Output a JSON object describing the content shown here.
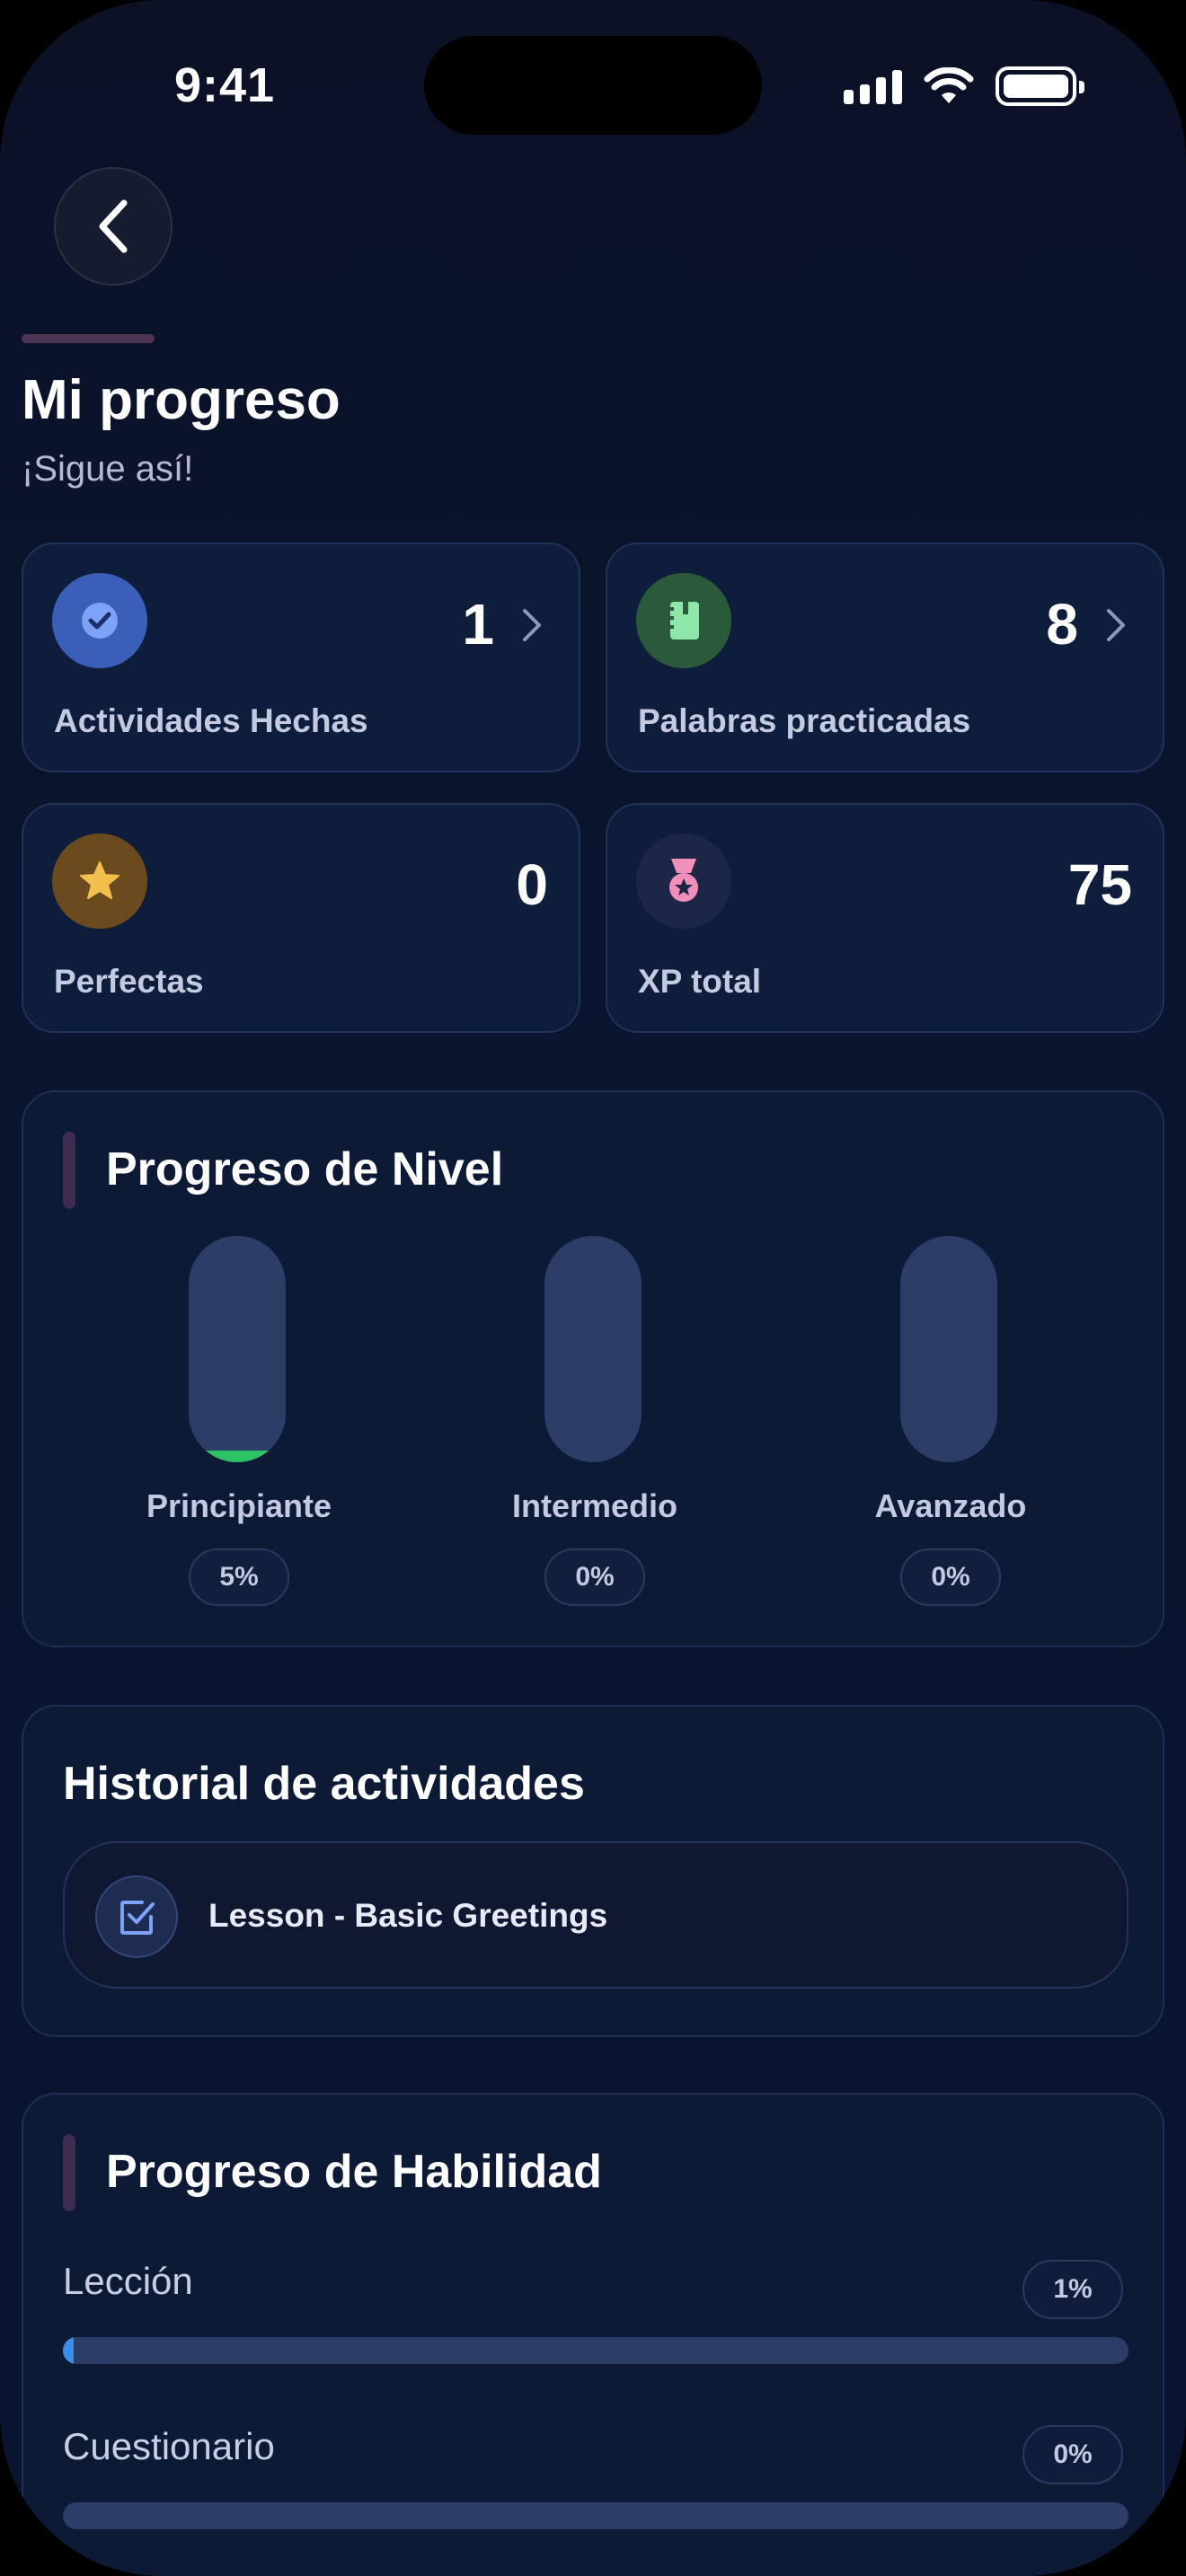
{
  "status_bar": {
    "time": "9:41"
  },
  "header": {
    "title": "Mi progreso",
    "subtitle": "¡Sigue así!"
  },
  "stats": [
    {
      "label": "Actividades Hechas",
      "value": "1",
      "icon": "check-circle-icon",
      "color": "#3b5fb8",
      "has_chevron": true
    },
    {
      "label": "Palabras practicadas",
      "value": "8",
      "icon": "notebook-icon",
      "color": "#2b5a3a",
      "has_chevron": true
    },
    {
      "label": "Perfectas",
      "value": "0",
      "icon": "star-icon",
      "color": "#6b4a1e",
      "has_chevron": false
    },
    {
      "label": "XP total",
      "value": "75",
      "icon": "medal-icon",
      "color": "#1c2647",
      "has_chevron": false
    }
  ],
  "level_progress": {
    "title": "Progreso de Nivel",
    "levels": [
      {
        "name": "Principiante",
        "percent_label": "5%",
        "fraction": 0.05
      },
      {
        "name": "Intermedio",
        "percent_label": "0%",
        "fraction": 0
      },
      {
        "name": "Avanzado",
        "percent_label": "0%",
        "fraction": 0
      }
    ]
  },
  "history": {
    "title": "Historial de actividades",
    "items": [
      {
        "label": "Lesson - Basic Greetings",
        "icon": "checkbox-icon"
      }
    ]
  },
  "skill_progress": {
    "title": "Progreso de Habilidad",
    "skills": [
      {
        "name": "Lección",
        "percent_label": "1%",
        "fraction": 0.01
      },
      {
        "name": "Cuestionario",
        "percent_label": "0%",
        "fraction": 0
      }
    ]
  },
  "colors": {
    "accent_green": "#2ec267",
    "accent_blue": "#3b8ee8",
    "background": "#0b1226"
  }
}
